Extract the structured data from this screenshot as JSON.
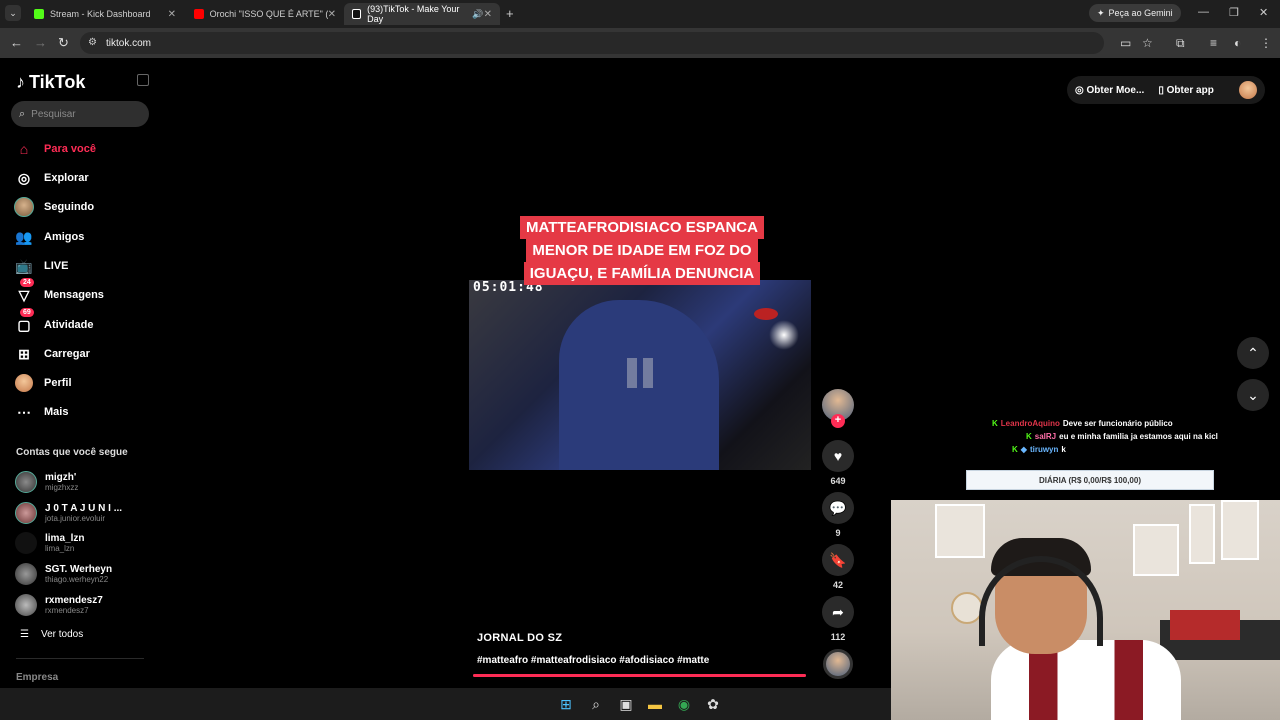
{
  "browser": {
    "tabs": [
      {
        "title": "Stream - Kick Dashboard",
        "active": false,
        "favicon_color": "#53fc18"
      },
      {
        "title": "Orochi \"ISSO QUE É ARTE\" (pro",
        "active": false,
        "favicon_color": "#ff0000"
      },
      {
        "title": "(93)TikTok - Make Your Day",
        "active": true,
        "favicon_color": "#111111"
      }
    ],
    "url": "tiktok.com",
    "gemini_label": "Peça ao Gemini"
  },
  "sidebar": {
    "logo": "TikTok",
    "search_placeholder": "Pesquisar",
    "nav": [
      {
        "label": "Para você",
        "icon": "home-icon",
        "active": true
      },
      {
        "label": "Explorar",
        "icon": "compass-icon"
      },
      {
        "label": "Seguindo",
        "icon": "following-avatar-icon"
      },
      {
        "label": "Amigos",
        "icon": "friends-icon"
      },
      {
        "label": "LIVE",
        "icon": "live-tv-icon"
      },
      {
        "label": "Mensagens",
        "icon": "messages-icon",
        "badge": "24"
      },
      {
        "label": "Atividade",
        "icon": "activity-icon",
        "badge": "69"
      },
      {
        "label": "Carregar",
        "icon": "upload-icon"
      },
      {
        "label": "Perfil",
        "icon": "profile-avatar-icon"
      },
      {
        "label": "Mais",
        "icon": "more-icon"
      }
    ],
    "following_title": "Contas que você segue",
    "following": [
      {
        "name": "migzh'",
        "handle": "migzhxzz"
      },
      {
        "name": "J 0 T A  J U N I ...",
        "handle": "jota.junior.evoluir"
      },
      {
        "name": "lima_lzn",
        "handle": "lima_lzn"
      },
      {
        "name": "SGT. Werheyn",
        "handle": "thiago.werheyn22"
      },
      {
        "name": "rxmendesz7",
        "handle": "rxmendesz7"
      }
    ],
    "see_all": "Ver todos",
    "footer": "Empresa"
  },
  "topright": {
    "coins": "Obter Moe...",
    "app": "Obter app"
  },
  "video": {
    "headline": [
      "MATTEAFRODISIACO ESPANCA",
      "MENOR DE IDADE EM FOZ DO",
      "IGUAÇU, E FAMÍLIA DENUNCIA"
    ],
    "timestamp": "05:01:48",
    "author": "JORNAL DO SZ",
    "hashtags": "#matteafro #matteafrodisiaco #afodisiaco #matte",
    "progress": 1.0
  },
  "actions": {
    "likes": "649",
    "comments": "9",
    "saves": "42",
    "shares": "112"
  },
  "stream_overlay": {
    "chat": [
      {
        "user": "LeandroAquino",
        "message": "Deve ser funcionário público",
        "user_color": "#e0344a"
      },
      {
        "user": "salRJ",
        "message": "eu e minha familia ja estamos aqui na kicl",
        "user_color": "#ff6fa8"
      },
      {
        "user": "tiruwyn",
        "message": "k",
        "user_color": "#6ab7ff"
      }
    ],
    "goal": "DIÁRIA (R$ 0,00/R$ 100,00)"
  },
  "colors": {
    "tiktok_red": "#fe2c55",
    "kick_green": "#53fc18"
  }
}
